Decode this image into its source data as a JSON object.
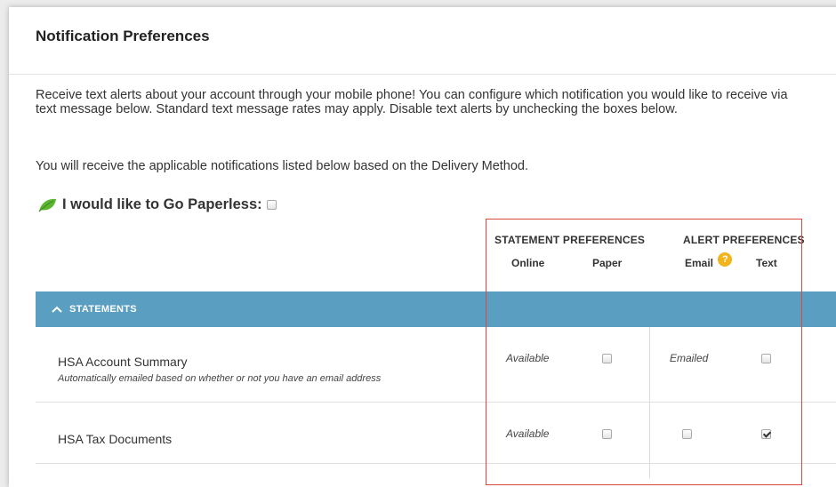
{
  "header": {
    "title": "Notification Preferences"
  },
  "intro": {
    "paragraph1": "Receive text alerts about your account through your mobile phone! You can configure which notification you would like to receive via text message below. Standard text message rates may apply. Disable text alerts by unchecking the boxes below.",
    "paragraph2": "You will receive the applicable notifications listed below based on the Delivery Method."
  },
  "paperless": {
    "label": "I would like to Go Paperless:",
    "checked": false
  },
  "columns": {
    "statement_group": "STATEMENT PREFERENCES",
    "alert_group": "ALERT PREFERENCES",
    "online": "Online",
    "paper": "Paper",
    "email": "Email",
    "text": "Text",
    "help_glyph": "?"
  },
  "section": {
    "label": "STATEMENTS",
    "expanded": true,
    "icon": "chevron-up-icon"
  },
  "rows": [
    {
      "name": "HSA Account Summary",
      "subtext": "Automatically emailed based on whether or not you have an email address",
      "online": "Available",
      "paper_checked": false,
      "email": "Emailed",
      "text_checked": false
    },
    {
      "name": "HSA Tax Documents",
      "subtext": "",
      "online": "Available",
      "paper_checked": false,
      "email_checked": false,
      "text_checked": true
    }
  ],
  "colors": {
    "section_bar": "#5a9ec1",
    "highlight_border": "#e0463a",
    "help_icon": "#f3b41b",
    "leaf": "#5cb531"
  }
}
